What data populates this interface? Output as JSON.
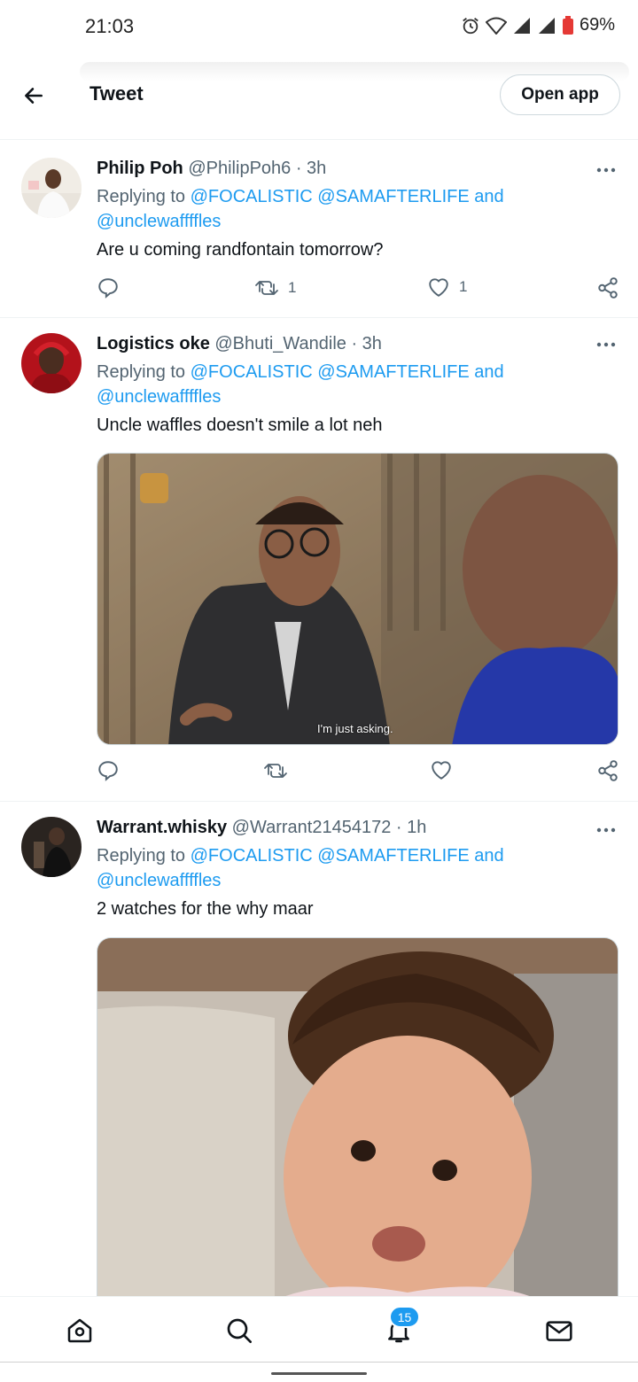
{
  "status_bar": {
    "time": "21:03",
    "battery": "69%"
  },
  "header": {
    "title": "Tweet",
    "open_app_label": "Open app"
  },
  "tweets": [
    {
      "name": "Philip Poh",
      "handle": "@PhilipPoh6",
      "time": "· 3h",
      "replying_prefix": "Replying to ",
      "mention1": "@FOCALISTIC",
      "mention2": "@SAMAFTERLIFE",
      "and": " and",
      "mention3": "@unclewaffffles",
      "text": "Are u coming randfontain tomorrow?",
      "retweets": "1",
      "likes": "1"
    },
    {
      "name": "Logistics oke",
      "handle": "@Bhuti_Wandile",
      "time": "· 3h",
      "replying_prefix": "Replying to ",
      "mention1": "@FOCALISTIC",
      "mention2": "@SAMAFTERLIFE",
      "and": " and",
      "mention3": "@unclewaffffles",
      "text": "Uncle waffles doesn't smile a lot neh",
      "media_caption": "I'm just asking.",
      "retweets": "",
      "likes": ""
    },
    {
      "name": "Warrant.whisky",
      "handle": "@Warrant21454172",
      "time": "· 1h",
      "replying_prefix": "Replying to ",
      "mention1": "@FOCALISTIC",
      "mention2": "@SAMAFTERLIFE",
      "and": " and",
      "mention3": "@unclewaffffles",
      "text": "2 watches for the why maar"
    }
  ],
  "bottom_nav": {
    "notifications_badge": "15"
  },
  "icons": {
    "back": "arrow-left-icon",
    "more": "more-horizontal-icon",
    "reply": "reply-icon",
    "retweet": "retweet-icon",
    "like": "heart-icon",
    "share": "share-icon",
    "home": "home-icon",
    "search": "search-icon",
    "notifications": "bell-icon",
    "messages": "mail-icon"
  },
  "colors": {
    "accent": "#1d9bf0",
    "text": "#0f1419",
    "secondary": "#536471"
  }
}
